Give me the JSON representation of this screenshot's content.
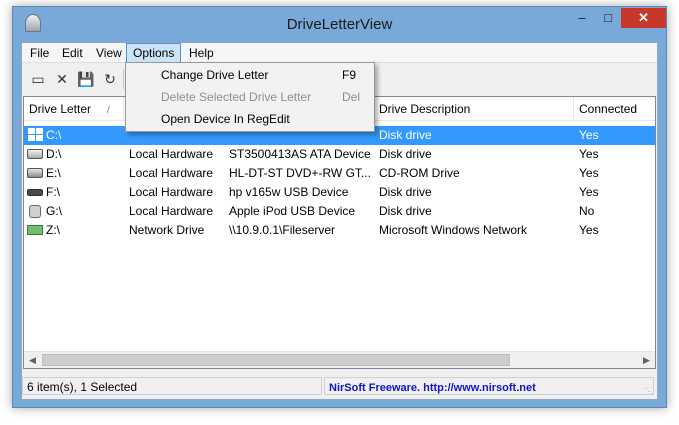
{
  "window": {
    "title": "DriveLetterView"
  },
  "menubar": [
    "File",
    "Edit",
    "View",
    "Options",
    "Help"
  ],
  "options_menu": [
    {
      "label": "Change Drive Letter",
      "shortcut": "F9",
      "enabled": true
    },
    {
      "label": "Delete Selected Drive Letter",
      "shortcut": "Del",
      "enabled": false
    },
    {
      "label": "Open Device In RegEdit",
      "shortcut": "",
      "enabled": true
    }
  ],
  "toolbar": [
    "drive-icon",
    "delete-icon",
    "save-icon",
    "refresh-icon"
  ],
  "table": {
    "columns": [
      "Drive Letter",
      "",
      "",
      "Drive Description",
      "Connected"
    ],
    "rows": [
      {
        "icon": "windows-drive-icon",
        "letter": "C:\\",
        "type": "",
        "device": "",
        "description": "Disk drive",
        "connected": "Yes",
        "selected": true
      },
      {
        "icon": "hard-drive-icon",
        "letter": "D:\\",
        "type": "Local Hardware",
        "device": "ST3500413AS ATA Device",
        "description": "Disk drive",
        "connected": "Yes",
        "selected": false
      },
      {
        "icon": "cd-drive-icon",
        "letter": "E:\\",
        "type": "Local Hardware",
        "device": "HL-DT-ST DVD+-RW GT...",
        "description": "CD-ROM Drive",
        "connected": "Yes",
        "selected": false
      },
      {
        "icon": "usb-drive-icon",
        "letter": "F:\\",
        "type": "Local Hardware",
        "device": "hp v165w USB Device",
        "description": "Disk drive",
        "connected": "Yes",
        "selected": false
      },
      {
        "icon": "ipod-icon",
        "letter": "G:\\",
        "type": "Local Hardware",
        "device": "Apple iPod USB Device",
        "description": "Disk drive",
        "connected": "No",
        "selected": false
      },
      {
        "icon": "network-drive-icon",
        "letter": "Z:\\",
        "type": "Network Drive",
        "device": "\\\\10.9.0.1\\Fileserver",
        "description": "Microsoft Windows Network",
        "connected": "Yes",
        "selected": false
      }
    ]
  },
  "statusbar": {
    "count": "6 item(s), 1 Selected",
    "credit": "NirSoft Freeware.  http://www.nirsoft.net"
  },
  "colors": {
    "selection": "#3399ff",
    "close_button": "#c7372b",
    "frame": "#78a9d8",
    "link": "#1414c8"
  }
}
